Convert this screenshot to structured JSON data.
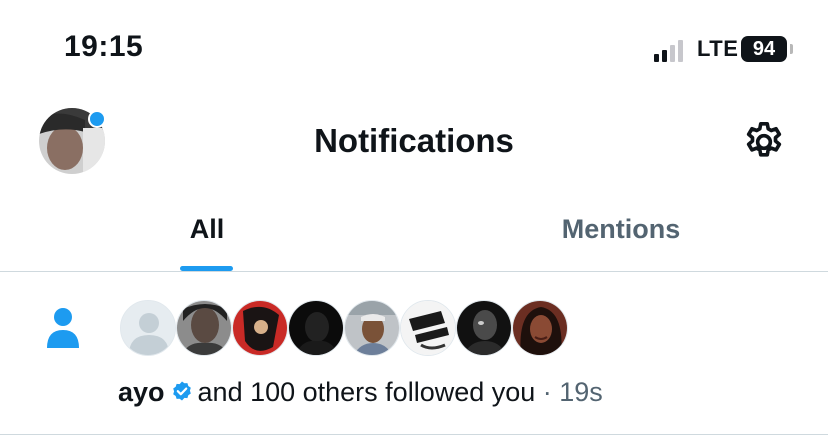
{
  "status_bar": {
    "time": "19:15",
    "network": "LTE",
    "battery": "94"
  },
  "header": {
    "title": "Notifications",
    "avatar_icon": "profile-avatar",
    "settings_icon": "gear-icon"
  },
  "tabs": [
    {
      "label": "All",
      "selected": true
    },
    {
      "label": "Mentions",
      "selected": false
    }
  ],
  "notification": {
    "icon": "person-icon",
    "username": "ayo",
    "verified": true,
    "text": "and 100 others followed you",
    "time": " · 19s",
    "follower_avatars": [
      {
        "name": "default-avatar"
      },
      {
        "name": "follower-avatar"
      },
      {
        "name": "follower-avatar"
      },
      {
        "name": "follower-avatar"
      },
      {
        "name": "follower-avatar"
      },
      {
        "name": "follower-avatar"
      },
      {
        "name": "follower-avatar"
      },
      {
        "name": "follower-avatar"
      }
    ]
  },
  "colors": {
    "accent": "#1d9bf0",
    "text_primary": "#0f1419",
    "text_secondary": "#536471",
    "divider": "#cfd9de"
  }
}
